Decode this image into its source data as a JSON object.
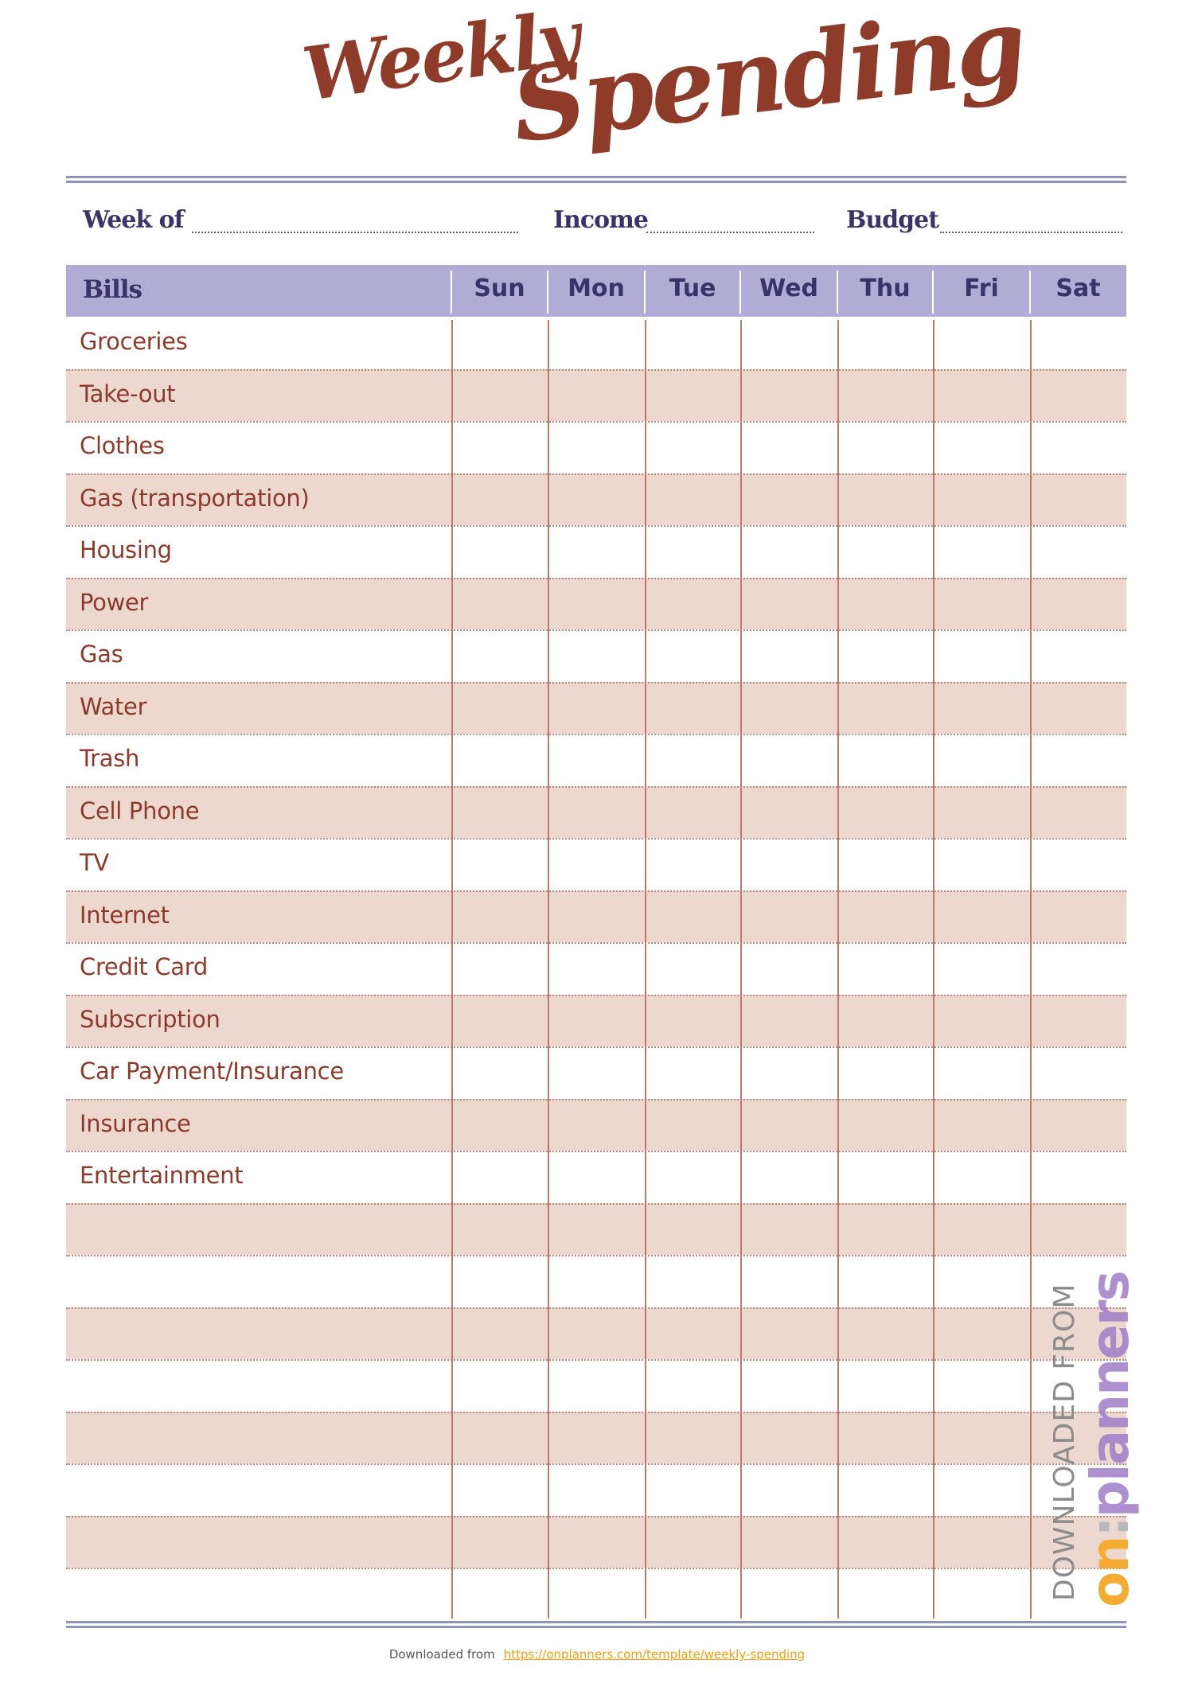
{
  "title": {
    "line1": "Weekly",
    "line2": "Spending"
  },
  "fields": {
    "week_of": {
      "label": "Week of",
      "value": ""
    },
    "income": {
      "label": "Income",
      "value": ""
    },
    "budget": {
      "label": "Budget",
      "value": ""
    }
  },
  "table": {
    "header": {
      "bills": "Bills",
      "days": [
        "Sun",
        "Mon",
        "Tue",
        "Wed",
        "Thu",
        "Fri",
        "Sat"
      ]
    },
    "rows": [
      "Groceries",
      "Take-out",
      "Clothes",
      "Gas (transportation)",
      "Housing",
      "Power",
      "Gas",
      "Water",
      "Trash",
      "Cell Phone",
      "TV",
      "Internet",
      "Credit Card",
      "Subscription",
      "Car Payment/Insurance",
      "Insurance",
      "Entertainment",
      "",
      "",
      "",
      "",
      "",
      "",
      "",
      ""
    ]
  },
  "watermark": {
    "prefix": "DOWNLOADED FROM",
    "brand_on": "on",
    "brand_sep": ":",
    "brand_rest": "planners"
  },
  "footer": {
    "text": "Downloaded from",
    "link": "https://onplanners.com/template/weekly-spending"
  },
  "colors": {
    "title": "#8f3b2a",
    "header_fill": "#b0acd6",
    "header_text": "#39336a",
    "row_shade": "#ecd8cf",
    "row_text": "#8e3a2a",
    "rule": "#9094b8",
    "brand_orange": "#f6ac33",
    "brand_purple": "#a07dc8"
  }
}
